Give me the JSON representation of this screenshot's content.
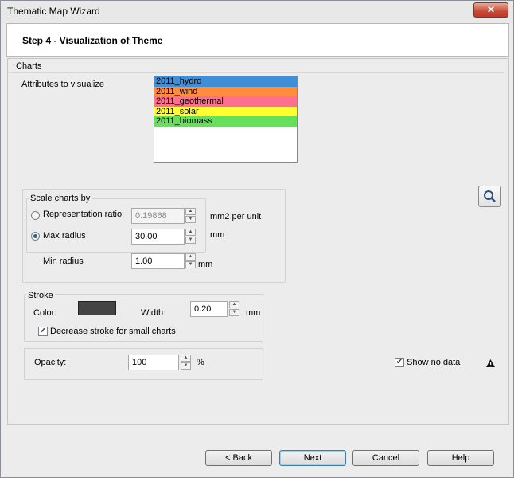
{
  "window": {
    "title": "Thematic Map Wizard",
    "close_glyph": "✕"
  },
  "header": {
    "title": "Step 4 - Visualization of Theme"
  },
  "charts_group": {
    "label": "Charts"
  },
  "attributes": {
    "label": "Attributes to visualize",
    "items": [
      {
        "label": "2011_hydro",
        "color": "#3f8fd8"
      },
      {
        "label": "2011_wind",
        "color": "#ff8c3f"
      },
      {
        "label": "2011_geothermal",
        "color": "#ff6f8f"
      },
      {
        "label": "2011_solar",
        "color": "#ffff33"
      },
      {
        "label": "2011_biomass",
        "color": "#66e05a"
      }
    ]
  },
  "scale": {
    "label": "Scale charts by",
    "representation_ratio_label": "Representation ratio:",
    "representation_ratio_value": "0.19868",
    "representation_ratio_unit": "mm2 per unit",
    "max_radius_label": "Max radius",
    "max_radius_value": "30.00",
    "max_radius_unit": "mm",
    "min_radius_label": "Min radius",
    "min_radius_value": "1.00",
    "min_radius_unit": "mm"
  },
  "stroke": {
    "label": "Stroke",
    "color_label": "Color:",
    "color_value": "#444444",
    "width_label": "Width:",
    "width_value": "0.20",
    "width_unit": "mm",
    "decrease_label": "Decrease stroke for small charts"
  },
  "opacity": {
    "label": "Opacity:",
    "value": "100",
    "unit": "%"
  },
  "show_no_data": {
    "label": "Show no data"
  },
  "buttons": {
    "back": "< Back",
    "next": "Next",
    "cancel": "Cancel",
    "help": "Help"
  }
}
